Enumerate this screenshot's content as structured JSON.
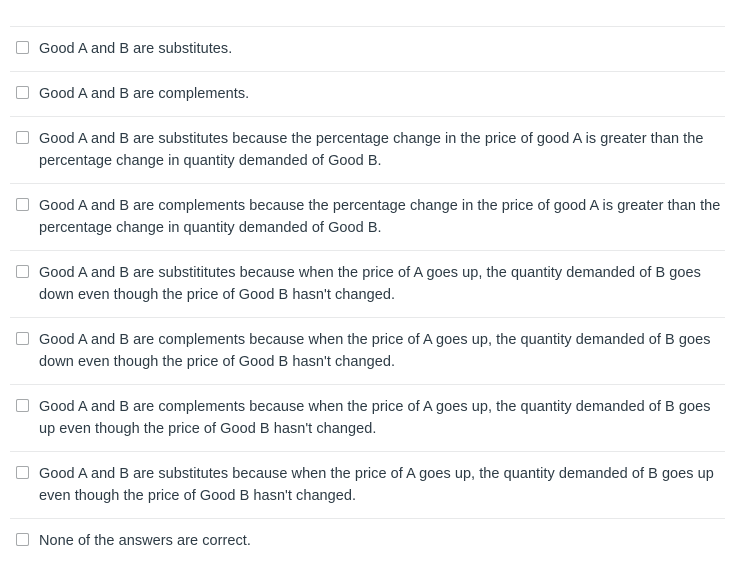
{
  "question": {
    "type": "multiple-answers",
    "answers": [
      {
        "id": "answer-1",
        "checked": false,
        "text": "Good A and B are substitutes."
      },
      {
        "id": "answer-2",
        "checked": false,
        "text": "Good A and B are complements."
      },
      {
        "id": "answer-3",
        "checked": false,
        "text": "Good A and B are substitutes because the percentage change in the price of good A is greater than the percentage change in quantity demanded of Good B."
      },
      {
        "id": "answer-4",
        "checked": false,
        "text": "Good A and B are complements because the percentage change in the price of good A is greater than the percentage change in quantity demanded of Good B."
      },
      {
        "id": "answer-5",
        "checked": false,
        "text": "Good A and B are substititutes because when the price of A goes up, the quantity demanded of B goes down even though the price of Good B hasn't changed."
      },
      {
        "id": "answer-6",
        "checked": false,
        "text": "Good A and B are complements because when the price of A goes up, the quantity demanded of B goes down even though the price of Good B hasn't changed."
      },
      {
        "id": "answer-7",
        "checked": false,
        "text": "Good A and B are complements because when the price of A goes up, the quantity demanded of B goes up even though the price of Good B hasn't changed."
      },
      {
        "id": "answer-8",
        "checked": false,
        "text": "Good A and B are substitutes because when the price of A goes up, the quantity demanded of B goes up even though the price of Good B hasn't changed."
      },
      {
        "id": "answer-9",
        "checked": false,
        "text": "None of the answers are correct."
      }
    ]
  },
  "colors": {
    "text": "#2d3b45",
    "separator": "#e8e9ea",
    "checkbox_border": "#a6a9ab",
    "background": "#ffffff"
  }
}
